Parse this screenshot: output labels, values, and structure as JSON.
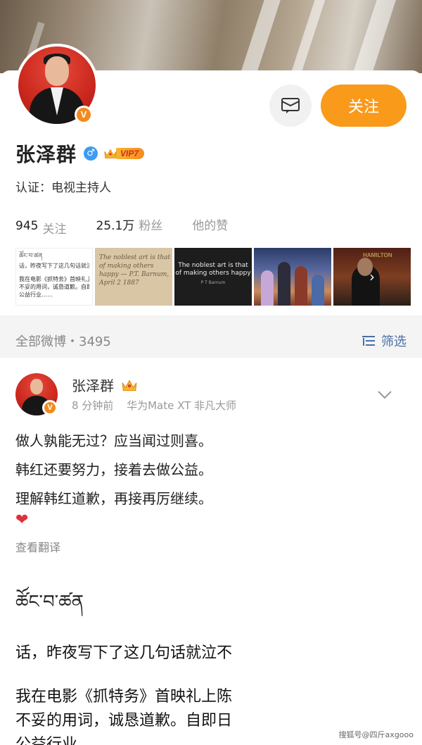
{
  "profile": {
    "name": "张泽群",
    "verified_badge": "V",
    "vip_label": "VIP7",
    "certification": "认证：电视主持人",
    "follow_label": "关注",
    "stats": {
      "following_num": "945",
      "following_label": "关注",
      "followers_num": "25.1万",
      "followers_label": "粉丝",
      "likes_label": "他的赞"
    }
  },
  "thumbnails": {
    "t1_header": "ཚོང་བ་ཚན",
    "t1_text_1": "话，昨夜写下了这几句话就泣不",
    "t1_text_2": "我在电影《抓特务》首映礼上",
    "t1_text_3": "不妥的用词，诚恳道歉。自即日",
    "t1_text_4": "公益行业……",
    "t2_text": "The noblest art is that of making others happy — P.T. Barnum, April 2 1887",
    "t3_text": "The noblest art is that of making others happy",
    "t3_author": "P T Barnum",
    "t5_sign": "HAMILTON",
    "more_icon": "›"
  },
  "feed": {
    "title": "全部微博・3495",
    "filter_label": "筛选"
  },
  "post": {
    "author": "张泽群",
    "time": "8 分钟前",
    "device": "华为Mate XT 非凡大师",
    "line1": "做人孰能无过？应当闻过则喜。",
    "line2": "韩红还要努力，接着去做公益。",
    "line3": "理解韩红道歉，再接再厉继续。",
    "emoji": "❤",
    "translate_label": "查看翻译"
  },
  "embed": {
    "header": "ཚོང་བ་ཚན",
    "line1": "话，昨夜写下了这几句话就泣不",
    "line2": "我在电影《抓特务》首映礼上陈",
    "line3": "不妥的用词，诚恳道歉。自即日",
    "line4": "公益行业……"
  },
  "watermark": "搜狐号@四斤axgooo",
  "colors": {
    "accent_orange": "#f99a1a",
    "link_blue": "#4a6fa5",
    "male_blue": "#3d9bf2"
  }
}
